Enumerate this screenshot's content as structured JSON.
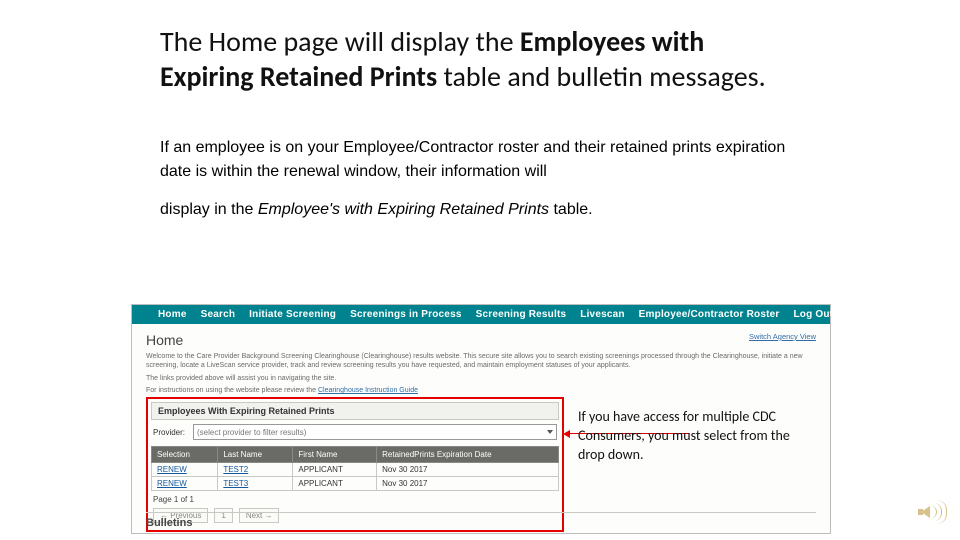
{
  "title": {
    "pre": "The Home page will display the ",
    "bold": "Employees with Expiring Retained Prints",
    "post": " table and bulletin messages."
  },
  "paragraph": {
    "p1": "If an employee is on your Employee/Contractor roster and their retained prints expiration date is within the renewal window, their information will",
    "p2_pre": "display in the ",
    "p2_italic": "Employee's with Expiring Retained Prints",
    "p2_post": " table."
  },
  "callout": "If you have access for multiple CDC Consumers, you must select from the drop down.",
  "screenshot": {
    "nav": [
      "Home",
      "Search",
      "Initiate Screening",
      "Screenings in Process",
      "Screening Results",
      "Livescan",
      "Employee/Contractor Roster",
      "Log Out"
    ],
    "switch_link": "Switch Agency View",
    "home_heading": "Home",
    "blurb1": "Welcome to the Care Provider Background Screening Clearinghouse (Clearinghouse) results website. This secure site allows you to search existing screenings processed through the Clearinghouse, initiate a new screening, locate a LiveScan service provider, track and review screening results you have requested, and maintain employment statuses of your applicants.",
    "blurb2": "The links provided above will assist you in navigating the site.",
    "blurb3_pre": "For instructions on using the website please review the ",
    "blurb3_link": "Clearinghouse Instruction Guide",
    "panel_title": "Employees With Expiring Retained Prints",
    "provider_label": "Provider:",
    "dropdown_placeholder": "(select provider to filter results)",
    "columns": [
      "Selection",
      "Last Name",
      "First Name",
      "RetainedPrints Expiration Date"
    ],
    "rows": [
      {
        "sel": "RENEW",
        "last": "TEST2",
        "first": "APPLICANT",
        "date": "Nov 30 2017"
      },
      {
        "sel": "RENEW",
        "last": "TEST3",
        "first": "APPLICANT",
        "date": "Nov 30 2017"
      }
    ],
    "page_label": "Page 1 of 1",
    "prev": "← Previous",
    "pg": "1",
    "next": "Next →",
    "bulletins": "Bulletins"
  }
}
